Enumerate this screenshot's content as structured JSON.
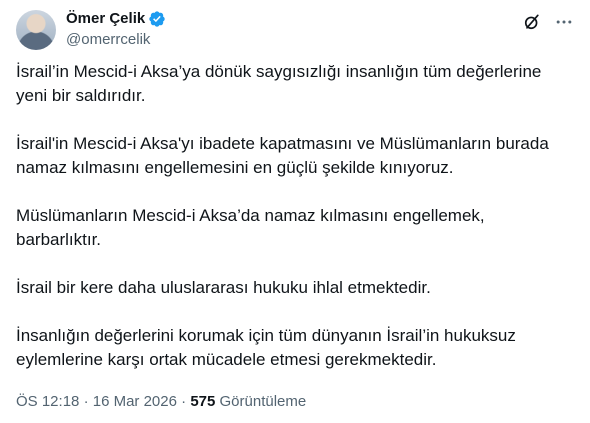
{
  "author": {
    "display_name": "Ömer Çelik",
    "handle": "@omerrcelik"
  },
  "icons": {
    "verified": "verified-badge-icon",
    "grok": "grok-icon",
    "more": "more-options-icon"
  },
  "colors": {
    "verified_blue": "#1d9bf0",
    "text": "#0f1419",
    "secondary": "#536471"
  },
  "tweet": {
    "paragraphs": [
      "İsrail’in Mescid-i Aksa’ya dönük saygısızlığı insanlığın tüm değerlerine yeni bir saldırıdır.",
      "İsrail'in Mescid-i Aksa'yı ibadete kapatmasını ve Müslümanların burada namaz kılmasını engellemesini en güçlü şekilde kınıyoruz.",
      "Müslümanların Mescid-i Aksa’da namaz kılmasını engellemek, barbarlıktır.",
      "İsrail bir kere daha uluslararası hukuku ihlal etmektedir.",
      "İnsanlığın değerlerini korumak için tüm dünyanın İsrail’in hukuksuz eylemlerine karşı ortak mücadele etmesi gerekmektedir."
    ]
  },
  "meta": {
    "time": "ÖS 12:18",
    "separator": "·",
    "date": "16 Mar 2026",
    "views_count": "575",
    "views_label": "Görüntüleme"
  }
}
